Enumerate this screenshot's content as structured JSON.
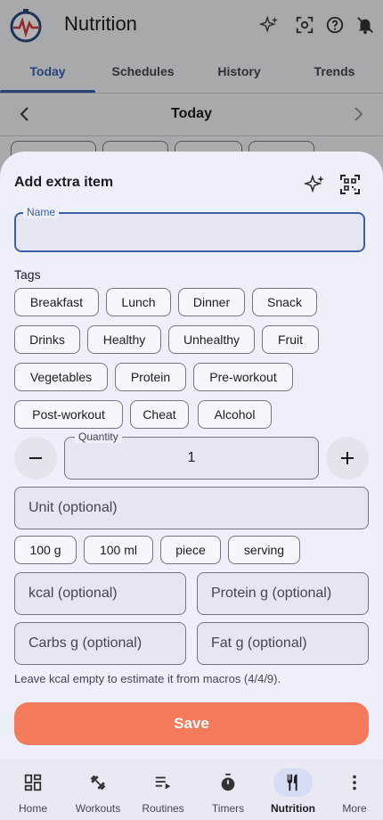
{
  "app": {
    "title": "Nutrition",
    "icons": [
      "sparkles-icon",
      "scan-icon",
      "help-icon",
      "notifications-off-icon"
    ]
  },
  "tabs": [
    {
      "label": "Today",
      "active": true
    },
    {
      "label": "Schedules",
      "active": false
    },
    {
      "label": "History",
      "active": false
    },
    {
      "label": "Trends",
      "active": false
    }
  ],
  "date_bar": {
    "label": "Today"
  },
  "sheet": {
    "title": "Add extra item",
    "name_field": {
      "label": "Name",
      "value": ""
    },
    "tags_label": "Tags",
    "tags": [
      "Breakfast",
      "Lunch",
      "Dinner",
      "Snack",
      "Drinks",
      "Healthy",
      "Unhealthy",
      "Fruit",
      "Vegetables",
      "Protein",
      "Pre-workout",
      "Post-workout",
      "Cheat",
      "Alcohol"
    ],
    "quantity": {
      "label": "Quantity",
      "value": "1"
    },
    "unit_placeholder": "Unit (optional)",
    "unit_chips": [
      "100 g",
      "100 ml",
      "piece",
      "serving"
    ],
    "kcal_placeholder": "kcal (optional)",
    "protein_placeholder": "Protein g (optional)",
    "carbs_placeholder": "Carbs g (optional)",
    "fat_placeholder": "Fat g (optional)",
    "hint": "Leave kcal empty to estimate it from macros (4/4/9).",
    "save_label": "Save",
    "accent_color": "#f37a5a"
  },
  "bottom_nav": [
    {
      "label": "Home",
      "icon": "dashboard-icon",
      "active": false
    },
    {
      "label": "Workouts",
      "icon": "dumbbell-icon",
      "active": false
    },
    {
      "label": "Routines",
      "icon": "playlist-icon",
      "active": false
    },
    {
      "label": "Timers",
      "icon": "stopwatch-icon",
      "active": false
    },
    {
      "label": "Nutrition",
      "icon": "fork-knife-icon",
      "active": true
    },
    {
      "label": "More",
      "icon": "more-vert-icon",
      "active": false
    }
  ]
}
